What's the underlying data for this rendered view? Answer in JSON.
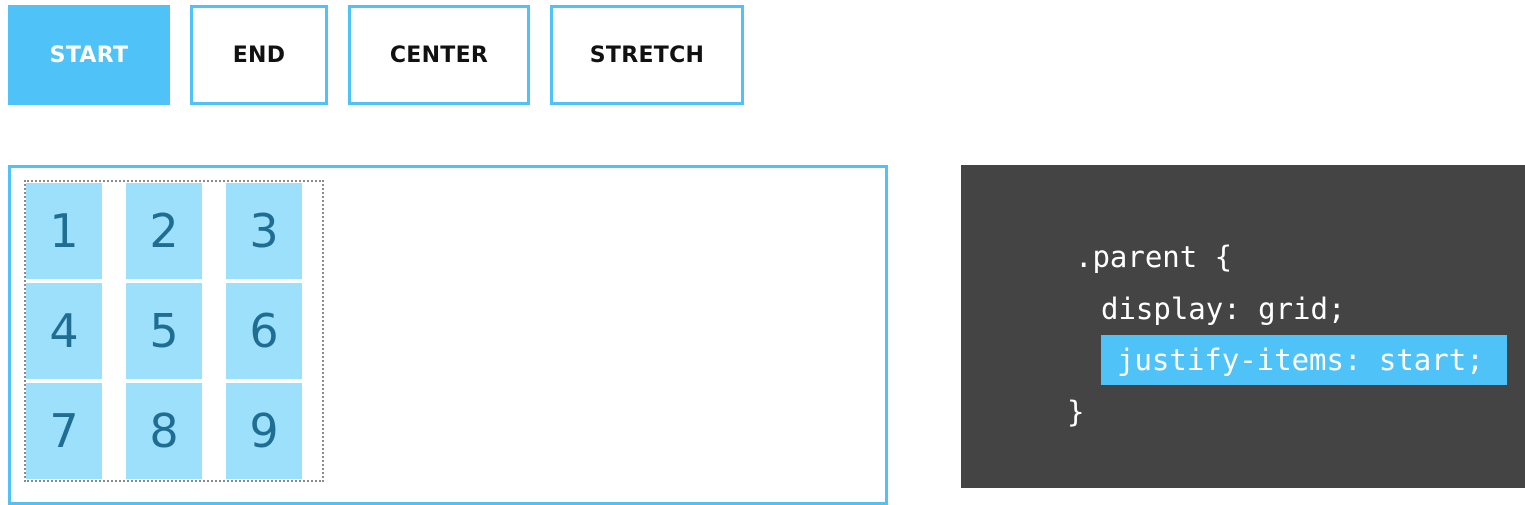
{
  "buttons": [
    {
      "label": "START",
      "active": true
    },
    {
      "label": "END",
      "active": false
    },
    {
      "label": "CENTER",
      "active": false
    },
    {
      "label": "STRETCH",
      "active": false
    }
  ],
  "grid": {
    "items": [
      "1",
      "2",
      "3",
      "4",
      "5",
      "6",
      "7",
      "8",
      "9"
    ]
  },
  "code": {
    "selector_line": ".parent {",
    "display_line": "display: grid;",
    "justify_line": "justify-items: start;",
    "closing_line": "}"
  },
  "colors": {
    "accent": "#4fc3f7",
    "cell_background": "#9de0fb",
    "cell_text": "#1f6d92",
    "code_background": "#444444"
  }
}
